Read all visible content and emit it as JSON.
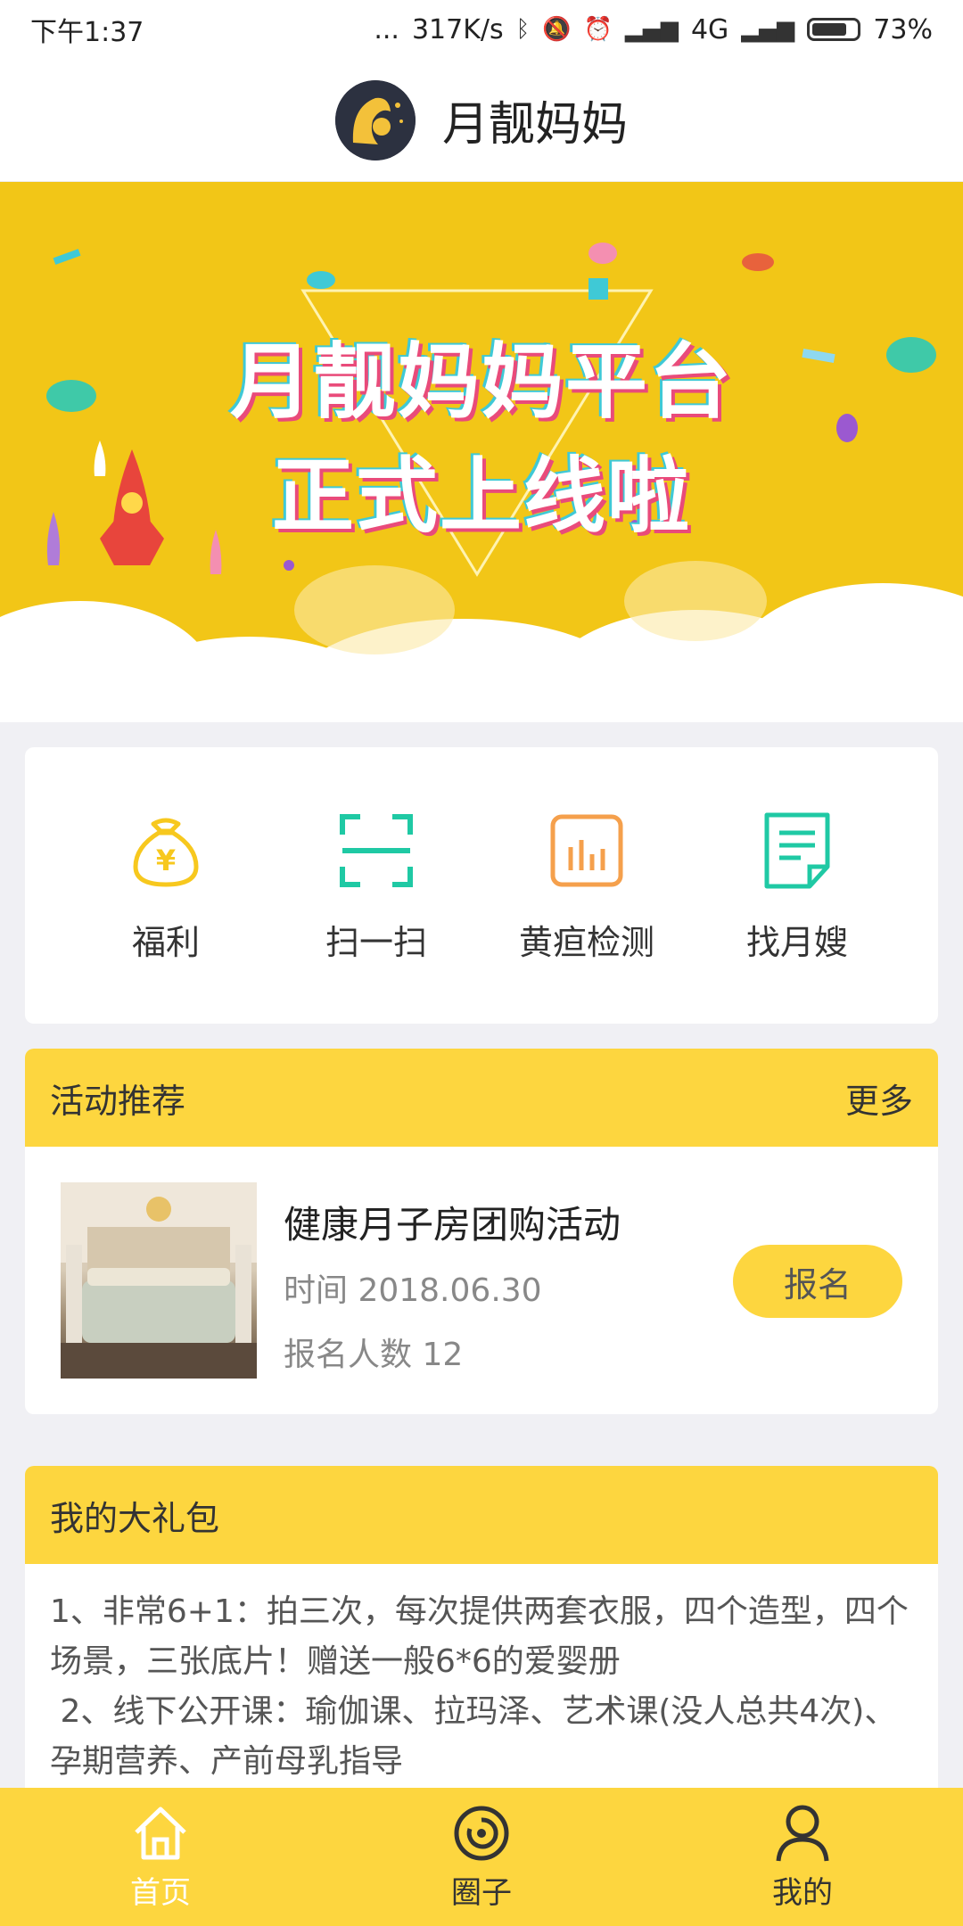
{
  "status": {
    "time": "下午1:37",
    "dots": "...",
    "speed": "317K/s",
    "network": "4G",
    "battery": "73%"
  },
  "header": {
    "title": "月靓妈妈"
  },
  "banner": {
    "line1": "月靓妈妈平台",
    "line2": "正式上线啦"
  },
  "quick": [
    {
      "label": "福利",
      "icon": "money-bag-icon",
      "color": "#f7c81e"
    },
    {
      "label": "扫一扫",
      "icon": "scan-icon",
      "color": "#1fc9a4"
    },
    {
      "label": "黄疸检测",
      "icon": "chart-icon",
      "color": "#f5a04c"
    },
    {
      "label": "找月嫂",
      "icon": "document-icon",
      "color": "#1fc9a4"
    }
  ],
  "activity": {
    "section_title": "活动推荐",
    "more": "更多",
    "item": {
      "title": "健康月子房团购活动",
      "time": "时间 2018.06.30",
      "count": "报名人数 12",
      "button": "报名"
    }
  },
  "gift": {
    "section_title": "我的大礼包",
    "line1": "1、非常6+1：拍三次，每次提供两套衣服，四个造型，四个场景，三张底片！赠送一般6*6的爱婴册",
    "line2": " 2、线下公开课：瑜伽课、拉玛泽、艺术课(没人总共4次)、孕期营养、产前母乳指导"
  },
  "tabs": [
    {
      "label": "首页",
      "icon": "home-icon",
      "active": true
    },
    {
      "label": "圈子",
      "icon": "circle-icon",
      "active": false
    },
    {
      "label": "我的",
      "icon": "person-icon",
      "active": false
    }
  ],
  "colors": {
    "accent": "#fdd63f",
    "banner": "#f2c617"
  }
}
